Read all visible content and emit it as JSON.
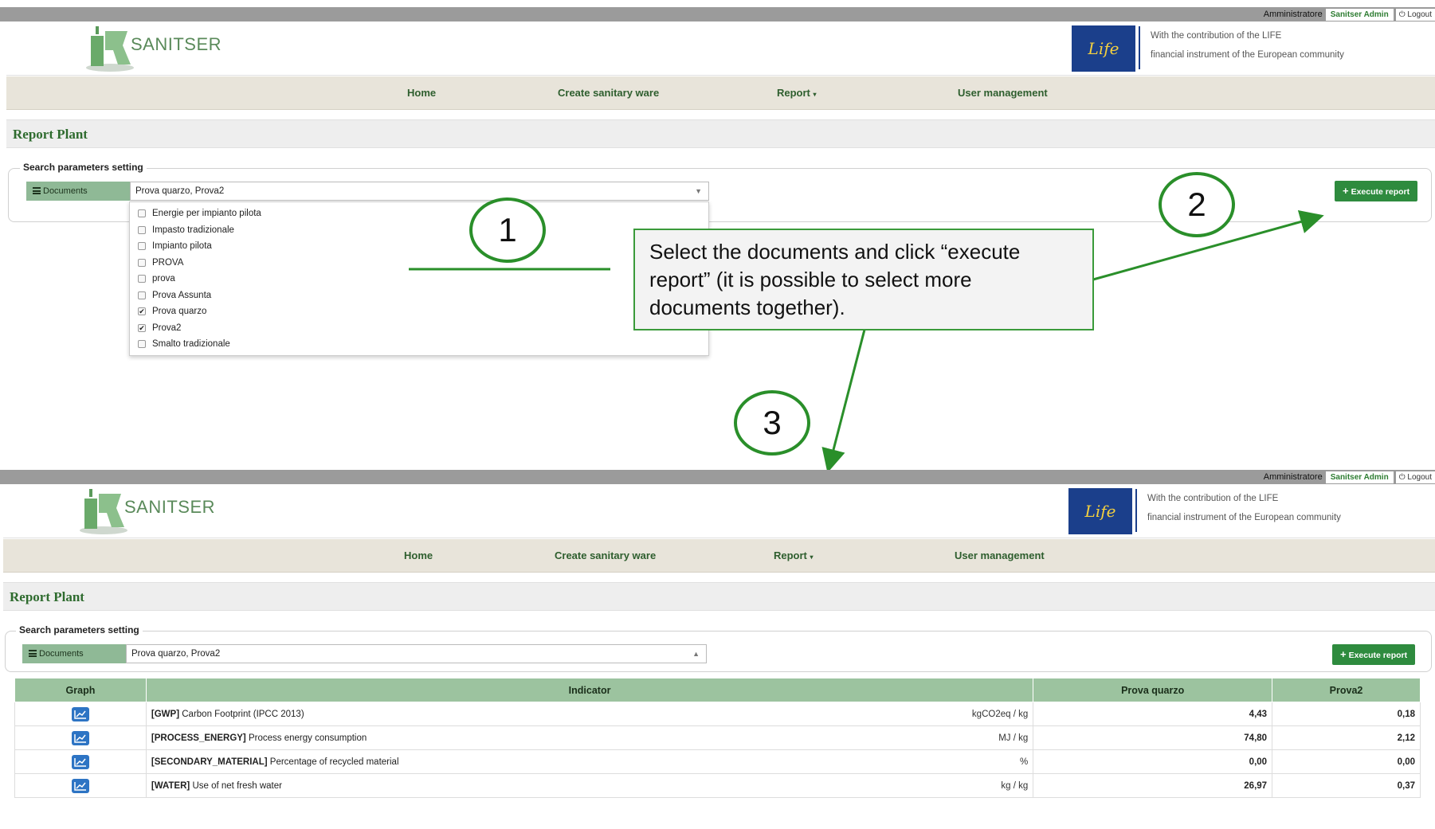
{
  "top": {
    "role": "Amministratore",
    "user": "Sanitser Admin",
    "logout": "Logout"
  },
  "header": {
    "logo": "SANITSER",
    "life_logo": "Life",
    "contribution_line1": "With the contribution of the LIFE",
    "contribution_line2": "financial instrument of the European community"
  },
  "nav": {
    "home": "Home",
    "create": "Create sanitary ware",
    "report": "Report",
    "users": "User management"
  },
  "page": {
    "title": "Report Plant",
    "legend": "Search parameters setting",
    "documents_label": "Documents",
    "selected_value": "Prova quarzo, Prova2",
    "execute_label": "Execute report"
  },
  "dropdown": {
    "items": [
      {
        "label": "Energie per impianto pilota",
        "checked": false
      },
      {
        "label": "Impasto tradizionale",
        "checked": false
      },
      {
        "label": "Impianto pilota",
        "checked": false
      },
      {
        "label": "PROVA",
        "checked": false
      },
      {
        "label": "prova",
        "checked": false
      },
      {
        "label": "Prova Assunta",
        "checked": false
      },
      {
        "label": "Prova quarzo",
        "checked": true
      },
      {
        "label": "Prova2",
        "checked": true
      },
      {
        "label": "Smalto tradizionale",
        "checked": false
      }
    ]
  },
  "annotations": {
    "step1": "1",
    "step2": "2",
    "step3": "3",
    "callout": "Select the documents and click “execute report” (it is possible to select more documents together)."
  },
  "table": {
    "headers": [
      "Graph",
      "Indicator",
      "Prova quarzo",
      "Prova2"
    ],
    "rows": [
      {
        "code": "[GWP]",
        "name": "Carbon Footprint (IPCC 2013)",
        "unit": "kgCO2eq / kg",
        "v1": "4,43",
        "v2": "0,18"
      },
      {
        "code": "[PROCESS_ENERGY]",
        "name": "Process energy consumption",
        "unit": "MJ / kg",
        "v1": "74,80",
        "v2": "2,12"
      },
      {
        "code": "[SECONDARY_MATERIAL]",
        "name": "Percentage of recycled material",
        "unit": "%",
        "v1": "0,00",
        "v2": "0,00"
      },
      {
        "code": "[WATER]",
        "name": "Use of net fresh water",
        "unit": "kg / kg",
        "v1": "26,97",
        "v2": "0,37"
      }
    ]
  },
  "colors": {
    "brand_green": "#2e8b3e",
    "annotation_green": "#2a8f2a",
    "table_header": "#9cc39f"
  }
}
